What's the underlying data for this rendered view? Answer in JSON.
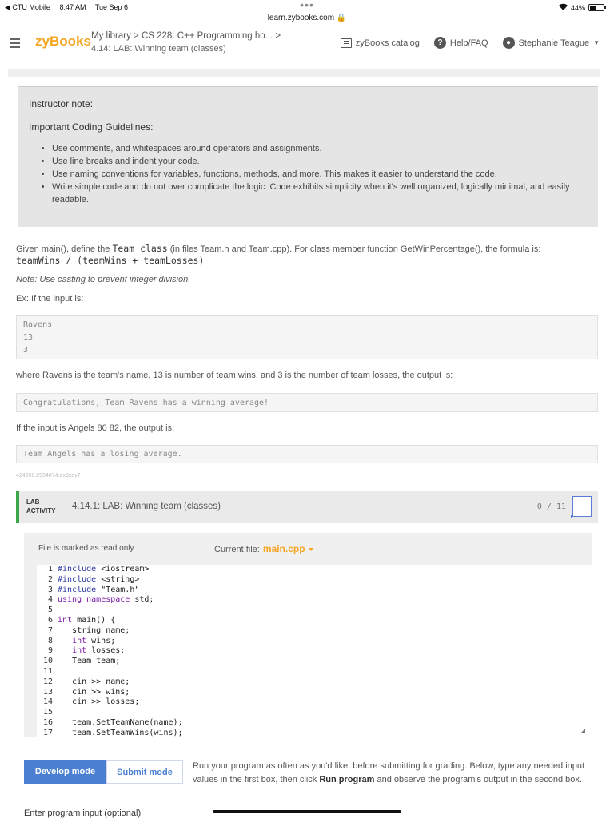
{
  "statusbar": {
    "back": "◀ CTU Mobile",
    "time": "8:47 AM",
    "date": "Tue Sep 6",
    "dots": "•••",
    "url": "learn.zybooks.com 🔒",
    "battery": "44%"
  },
  "nav": {
    "logo": "zyBooks",
    "breadcrumb": "My library > CS 228: C++ Programming ho...  >",
    "section": "4.14: LAB: Winning team (classes)",
    "catalog": "zyBooks catalog",
    "help": "Help/FAQ",
    "user": "Stephanie Teague"
  },
  "note": {
    "title": "Instructor note:",
    "subtitle": "Important Coding Guidelines:",
    "items": [
      "Use comments, and whitespaces around operators and assignments.",
      "Use line breaks and indent your code.",
      "Use naming conventions for variables, functions, methods, and more. This makes it easier to understand the code.",
      "Write simple code and do not over complicate the logic. Code exhibits simplicity when it's well organized, logically minimal, and easily readable."
    ]
  },
  "content": {
    "given_pre": "Given main(), define the ",
    "given_code": "Team class",
    "given_post": " (in files Team.h and Team.cpp). For class member function GetWinPercentage(), the formula is:",
    "formula": "teamWins / (teamWins + teamLosses)",
    "note": "Note: Use casting to prevent integer division.",
    "ex_label": "Ex: If the input is:",
    "input1": [
      "Ravens",
      "13",
      "3"
    ],
    "where_text": "where Ravens is the team's name, 13 is number of team wins, and 3 is the number of team losses, the output is:",
    "output1": "Congratulations, Team Ravens has a winning average!",
    "if_text": "If the input is Angels 80 82, the output is:",
    "output2": "Team Angels has a losing average.",
    "tiny_id": "424958.2904074.qx3zqy7"
  },
  "lab": {
    "tag_line1": "LAB",
    "tag_line2": "ACTIVITY",
    "title": "4.14.1: LAB: Winning team (classes)",
    "score": "0 / 11"
  },
  "editor": {
    "readonly": "File is marked as read only",
    "current_label": "Current file:",
    "current_file": "main.cpp"
  },
  "code_lines": [
    "#include <iostream>",
    "#include <string>",
    "#include \"Team.h\"",
    "using namespace std;",
    "",
    "int main() {",
    "   string name;",
    "   int wins;",
    "   int losses;",
    "   Team team;",
    "",
    "   cin >> name;",
    "   cin >> wins;",
    "   cin >> losses;",
    "",
    "   team.SetTeamName(name);",
    "   team.SetTeamWins(wins);"
  ],
  "run": {
    "develop": "Develop mode",
    "submit": "Submit mode",
    "text_pre": "Run your program as often as you'd like, before submitting for grading. Below, type any needed input values in the first box, then click ",
    "text_bold": "Run program",
    "text_post": " and observe the program's output in the second box.",
    "enter_label": "Enter program input (optional)"
  }
}
